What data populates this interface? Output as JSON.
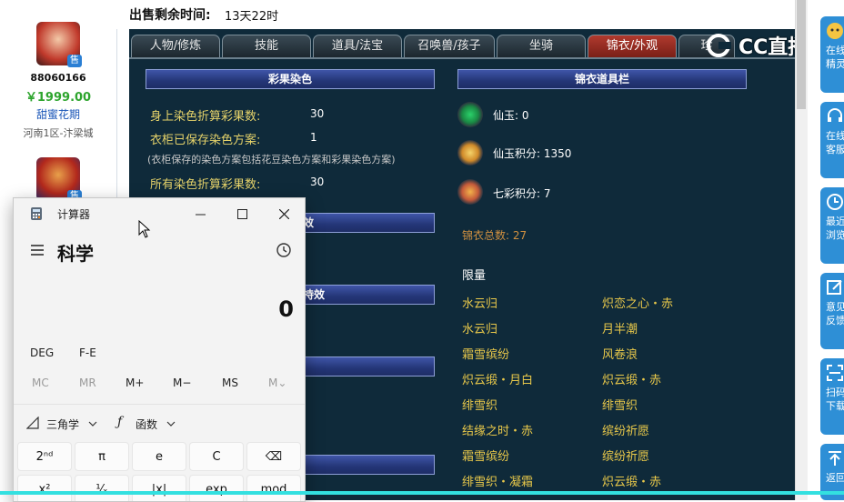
{
  "seller": {
    "id": "88060166",
    "price": "￥1999.00",
    "name": "甜蜜花期",
    "server": "河南1区-汴梁城",
    "badge": "售"
  },
  "header": {
    "time_label": "出售剩余时间:",
    "time_value": "13天22时"
  },
  "tabs": [
    "人物/修炼",
    "技能",
    "道具/法宝",
    "召唤兽/孩子",
    "坐骑",
    "锦衣/外观",
    "珍"
  ],
  "dye": {
    "title": "彩果染色",
    "rows": [
      {
        "label": "身上染色折算彩果数:",
        "value": "30"
      },
      {
        "label": "衣柜已保存染色方案:",
        "value": "1"
      },
      {
        "label": "所有染色折算彩果数:",
        "value": "30"
      }
    ],
    "note": "(衣柜保存的染色方案包括花豆染色方案和彩果染色方案)",
    "sub_bar_partial_1": "效",
    "sub_bar_partial_2": "持效"
  },
  "wardrobe": {
    "title": "锦衣道具栏",
    "stats": [
      {
        "icon": "jade-icon",
        "text": "仙玉: 0"
      },
      {
        "icon": "jade-points-icon",
        "text": "仙玉积分: 1350"
      },
      {
        "icon": "rainbow-points-icon",
        "text": "七彩积分: 7"
      }
    ],
    "total": "锦衣总数: 27",
    "limited_label": "限量",
    "items_left": [
      "水云归",
      "水云归",
      "霜雪缤纷",
      "炽云缎・月白",
      "绯雪织",
      "结缘之时・赤",
      "霜雪缤纷",
      "绯雪织・凝霜"
    ],
    "items_right": [
      "炽恋之心・赤",
      "月半潮",
      "风卷浪",
      "炽云缎・赤",
      "绯雪织",
      "缤纷祈愿",
      "缤纷祈愿",
      "炽云缎・赤"
    ]
  },
  "watermark": "CC直播",
  "sidebar": {
    "items": [
      {
        "label_1": "在线",
        "label_2": "精灵"
      },
      {
        "label_1": "在线",
        "label_2": "客服"
      },
      {
        "label_1": "最近",
        "label_2": "浏览"
      },
      {
        "label_1": "意见",
        "label_2": "反馈"
      },
      {
        "label_1": "扫码",
        "label_2": "下载"
      },
      {
        "label_1": "返回",
        "label_2": ""
      }
    ]
  },
  "calculator": {
    "title": "计算器",
    "mode": "科学",
    "display": "0",
    "deg": "DEG",
    "fe": "F-E",
    "memory": [
      "MC",
      "MR",
      "M+",
      "M−",
      "MS",
      "M⌄"
    ],
    "trig": "三角学",
    "func": "函数",
    "row1": [
      "2ⁿᵈ",
      "π",
      "e",
      "C",
      "⌫"
    ],
    "row2": [
      "x²",
      "¹⁄ₓ",
      "|x|",
      "exp",
      "mod"
    ]
  },
  "colors": {
    "panel_bg": "#0f2a3a",
    "accent_cyan": "#33e0e0",
    "active_tab": "#b03a2e",
    "item_gold": "#e8c84a",
    "sidebar_blue": "#2e8fd6"
  }
}
